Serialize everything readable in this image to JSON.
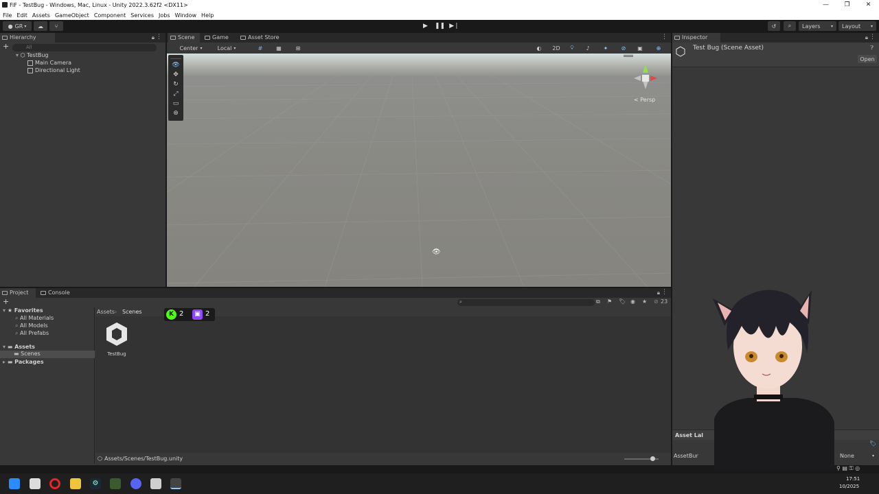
{
  "window": {
    "title": "FiF - TestBug - Windows, Mac, Linux - Unity 2022.3.62f2 <DX11>",
    "controls": [
      "—",
      "❐",
      "✕"
    ]
  },
  "menu": [
    "File",
    "Edit",
    "Assets",
    "GameObject",
    "Component",
    "Services",
    "Jobs",
    "Window",
    "Help"
  ],
  "toolbar": {
    "account": "GR",
    "layers_label": "Layers",
    "layout_label": "Layout"
  },
  "hierarchy": {
    "tab": "Hierarchy",
    "search_placeholder": "All",
    "scene_name": "TestBug",
    "items": [
      "Main Camera",
      "Directional Light"
    ]
  },
  "scene_tabs": [
    "Scene",
    "Game",
    "Asset Store"
  ],
  "scene_toolbar": {
    "pivot": "Center",
    "space": "Local",
    "mode_2d": "2D"
  },
  "scene_view": {
    "projection": "< Persp"
  },
  "inspector": {
    "tab": "Inspector",
    "title": "Test Bug (Scene Asset)",
    "open_button": "Open",
    "asset_labels": "Asset Lal",
    "asset_bundle": "AssetBur",
    "bundle_value": "None"
  },
  "project": {
    "tabs": [
      "Project",
      "Console"
    ],
    "favorites": {
      "label": "Favorites",
      "items": [
        "All Materials",
        "All Models",
        "All Prefabs"
      ]
    },
    "assets_label": "Assets",
    "scenes_label": "Scenes",
    "packages_label": "Packages",
    "breadcrumb": [
      "Assets",
      "Scenes"
    ],
    "asset_count": "23",
    "files": [
      {
        "name": "TestBug"
      }
    ],
    "status_path": "Assets/Scenes/TestBug.unity"
  },
  "overlay": {
    "kick_count": "2",
    "twitch_count": "2"
  },
  "clock": {
    "time": "17:51",
    "date": "10/2025"
  },
  "colors": {
    "kick_green": "#53fc18",
    "twitch_purple": "#9146ff"
  }
}
